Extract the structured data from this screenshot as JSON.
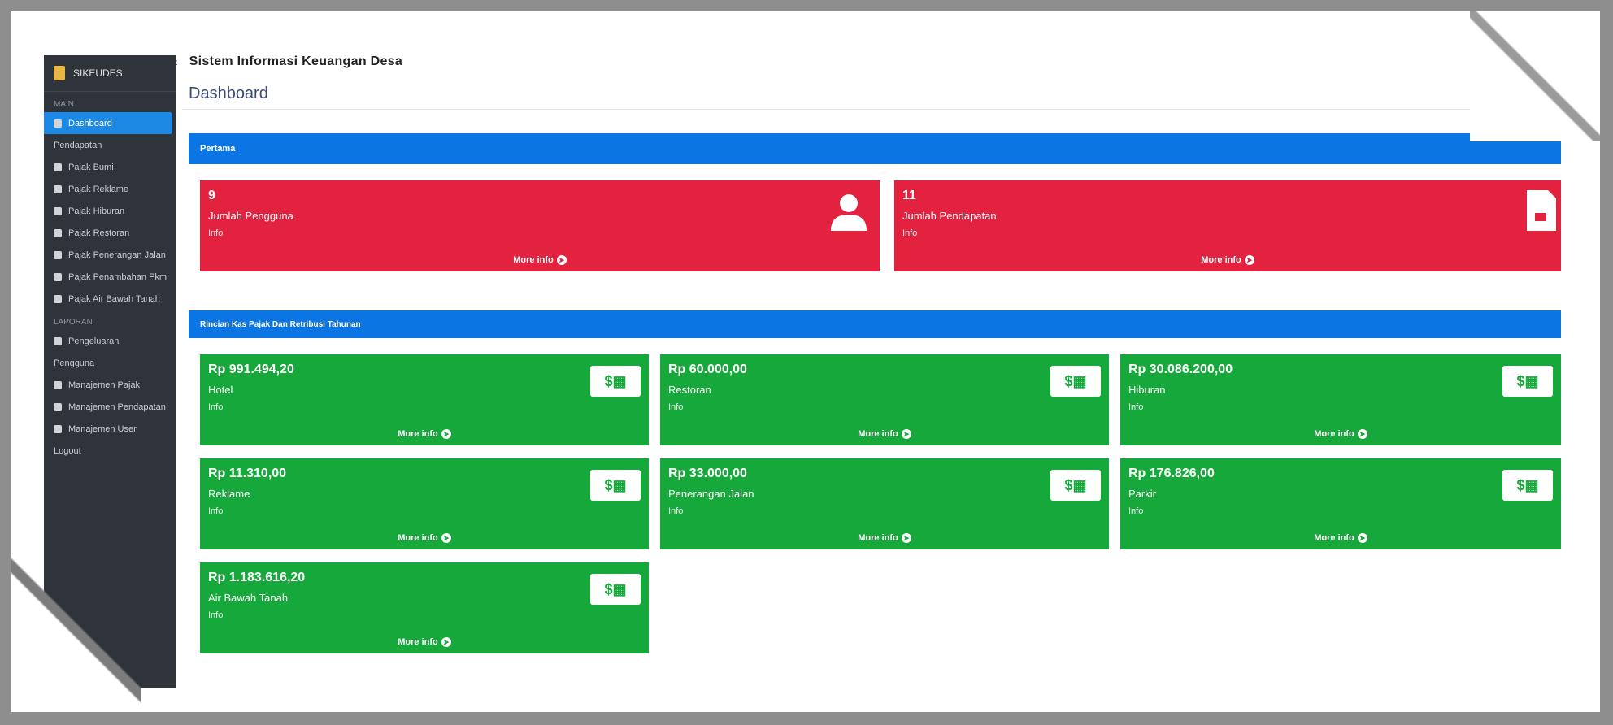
{
  "app": {
    "header_title": "Sistem Informasi Keuangan Desa"
  },
  "sidebar": {
    "brand": "SIKEUDES",
    "header_main": "MAIN",
    "items": [
      {
        "label": "Dashboard"
      },
      {
        "label": "Pendapatan"
      },
      {
        "label": "Pajak Bumi"
      },
      {
        "label": "Pajak Reklame"
      },
      {
        "label": "Pajak Hiburan"
      },
      {
        "label": "Pajak Restoran"
      },
      {
        "label": "Pajak Penerangan Jalan"
      },
      {
        "label": "Pajak Penambahan Pkm"
      },
      {
        "label": "Pajak Air Bawah Tanah"
      }
    ],
    "header_report": "LAPORAN",
    "items2": [
      {
        "label": "Pengeluaran"
      },
      {
        "label": "Pengguna"
      },
      {
        "label": "Manajemen Pajak"
      },
      {
        "label": "Manajemen Pendapatan"
      },
      {
        "label": "Manajemen User"
      },
      {
        "label": "Logout"
      }
    ]
  },
  "page": {
    "title": "Dashboard"
  },
  "panels": {
    "first": "Pertama",
    "second": "Rincian Kas Pajak Dan Retribusi Tahunan"
  },
  "cards_red": [
    {
      "value": "9",
      "label": "Jumlah Pengguna",
      "sub": "Info",
      "more": "More info"
    },
    {
      "value": "11",
      "label": "Jumlah Pendapatan",
      "sub": "Info",
      "more": "More info"
    }
  ],
  "cards_green": [
    {
      "value": "Rp 991.494,20",
      "label": "Hotel",
      "sub": "Info",
      "more": "More info"
    },
    {
      "value": "Rp 60.000,00",
      "label": "Restoran",
      "sub": "Info",
      "more": "More info"
    },
    {
      "value": "Rp 30.086.200,00",
      "label": "Hiburan",
      "sub": "Info",
      "more": "More info"
    },
    {
      "value": "Rp 11.310,00",
      "label": "Reklame",
      "sub": "Info",
      "more": "More info"
    },
    {
      "value": "Rp 33.000,00",
      "label": "Penerangan Jalan",
      "sub": "Info",
      "more": "More info"
    },
    {
      "value": "Rp 176.826,00",
      "label": "Parkir",
      "sub": "Info",
      "more": "More info"
    },
    {
      "value": "Rp 1.183.616,20",
      "label": "Air Bawah Tanah",
      "sub": "Info",
      "more": "More info"
    }
  ],
  "icons": {
    "money": "money-icon",
    "user": "user-icon",
    "document": "document-icon"
  },
  "colors": {
    "primary": "#0b75e3",
    "danger": "#e2223f",
    "success": "#16a83a",
    "sidebar": "#2e343a"
  }
}
